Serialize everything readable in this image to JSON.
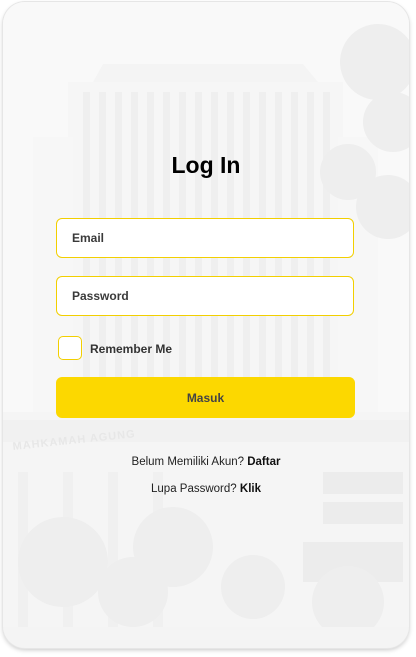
{
  "login": {
    "title": "Log In",
    "email_placeholder": "Email",
    "password_placeholder": "Password",
    "remember_label": "Remember Me",
    "submit_label": "Masuk"
  },
  "register": {
    "prompt": "Belum Memiliki Akun?",
    "link": "Daftar"
  },
  "forgot": {
    "prompt": "Lupa Password?",
    "link": "Klik"
  },
  "background": {
    "building_sign": "MAHKAMAH AGUNG"
  },
  "colors": {
    "accent": "#fcd800",
    "field_border": "#f2cf00"
  }
}
